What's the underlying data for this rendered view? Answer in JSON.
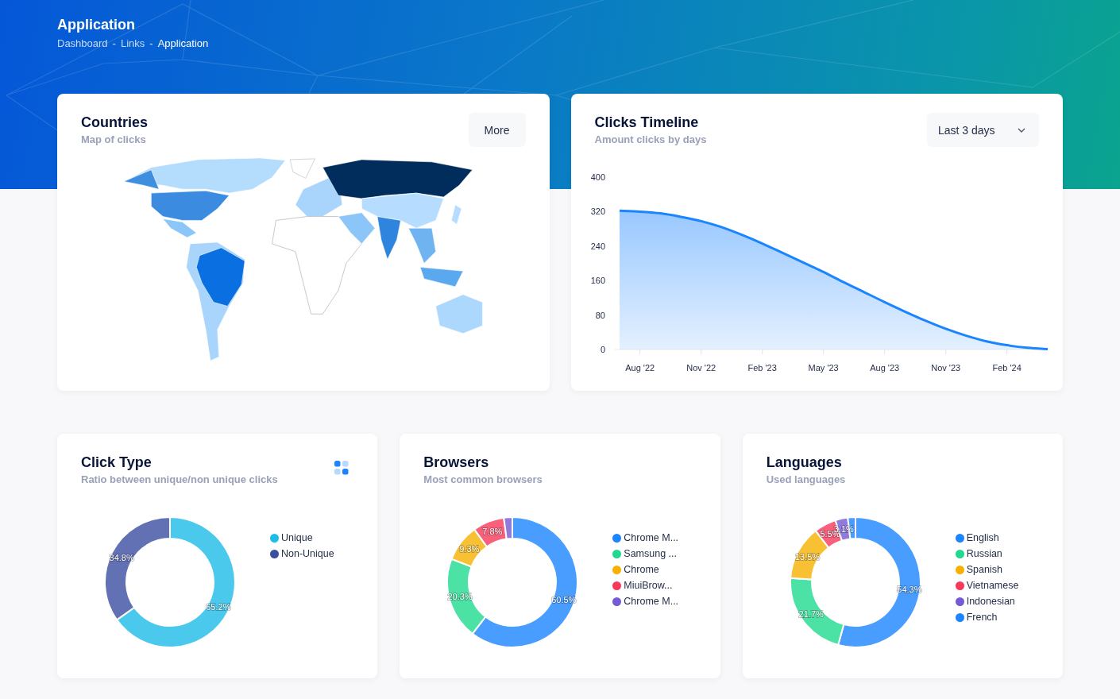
{
  "header": {
    "title": "Application",
    "breadcrumb": [
      {
        "kind": "link",
        "text": "Dashboard"
      },
      {
        "kind": "separator",
        "text": "-"
      },
      {
        "kind": "link",
        "text": "Links"
      },
      {
        "kind": "separator",
        "text": "-"
      },
      {
        "kind": "current",
        "text": "Application"
      }
    ]
  },
  "countries": {
    "title": "Countries",
    "subtitle": "Map of clicks",
    "button": "More"
  },
  "timeline": {
    "title": "Clicks Timeline",
    "subtitle": "Amount clicks by days",
    "dropdown": "Last 3 days",
    "chart_data": {
      "type": "area",
      "categories": [
        null,
        "Aug '22",
        null,
        null,
        "Nov '22",
        null,
        null,
        "Feb '23",
        null,
        null,
        "May '23",
        null,
        null,
        "Aug '23",
        null,
        null,
        "Nov '23",
        null,
        null,
        "Feb '24",
        null,
        null
      ],
      "series": [
        {
          "color": "#1b84ff",
          "values": [
            322,
            320,
            316,
            308,
            298,
            284,
            266,
            246,
            224,
            202,
            180,
            156,
            133,
            110,
            88,
            67,
            48,
            32,
            19,
            10,
            4,
            1
          ]
        }
      ],
      "ylim": [
        0,
        400
      ],
      "yticks": [
        0,
        80,
        160,
        240,
        320,
        400
      ]
    }
  },
  "donuts": [
    {
      "title": "Click Type",
      "subtitle": "Ratio between unique/non unique clicks",
      "has_options": true,
      "legend": [
        {
          "color": "#1ebce8"
        },
        {
          "color": "#3b4ea0"
        }
      ],
      "chart_data": {
        "type": "donut",
        "categories": [
          "Unique",
          "Non-Unique"
        ],
        "values": [
          65.2,
          34.8
        ],
        "value_labels": [
          "65.2%",
          "34.8%"
        ]
      }
    },
    {
      "title": "Browsers",
      "subtitle": "Most common browsers",
      "has_options": false,
      "legend": [
        {
          "color": "#1b84ff"
        },
        {
          "color": "#1fd98f"
        },
        {
          "color": "#f6b100"
        },
        {
          "color": "#f8385a"
        },
        {
          "color": "#7559d6"
        }
      ],
      "chart_data": {
        "type": "donut",
        "categories": [
          "Chrome M...",
          "Samsung ...",
          "Chrome",
          "MiuiBrow...",
          "Chrome M..."
        ],
        "values": [
          60.5,
          20.3,
          9.3,
          7.8,
          2.1
        ],
        "value_labels": [
          "60.5%",
          "20.3%",
          "9.3%",
          "7.8%",
          null
        ]
      }
    },
    {
      "title": "Languages",
      "subtitle": "Used languages",
      "has_options": false,
      "legend": [
        {
          "color": "#1b84ff"
        },
        {
          "color": "#1fd98f"
        },
        {
          "color": "#f6b100"
        },
        {
          "color": "#f8385a"
        },
        {
          "color": "#7559d6"
        },
        {
          "color": "#1b84ff"
        }
      ],
      "chart_data": {
        "type": "donut",
        "categories": [
          "English",
          "Russian",
          "Spanish",
          "Vietnamese",
          "Indonesian",
          "French"
        ],
        "values": [
          54.3,
          21.7,
          13.5,
          5.5,
          3.1,
          1.9
        ],
        "value_labels": [
          "54.3%",
          "21.7%",
          "13.5%",
          "5.5%",
          "3.1%",
          null
        ]
      }
    }
  ]
}
